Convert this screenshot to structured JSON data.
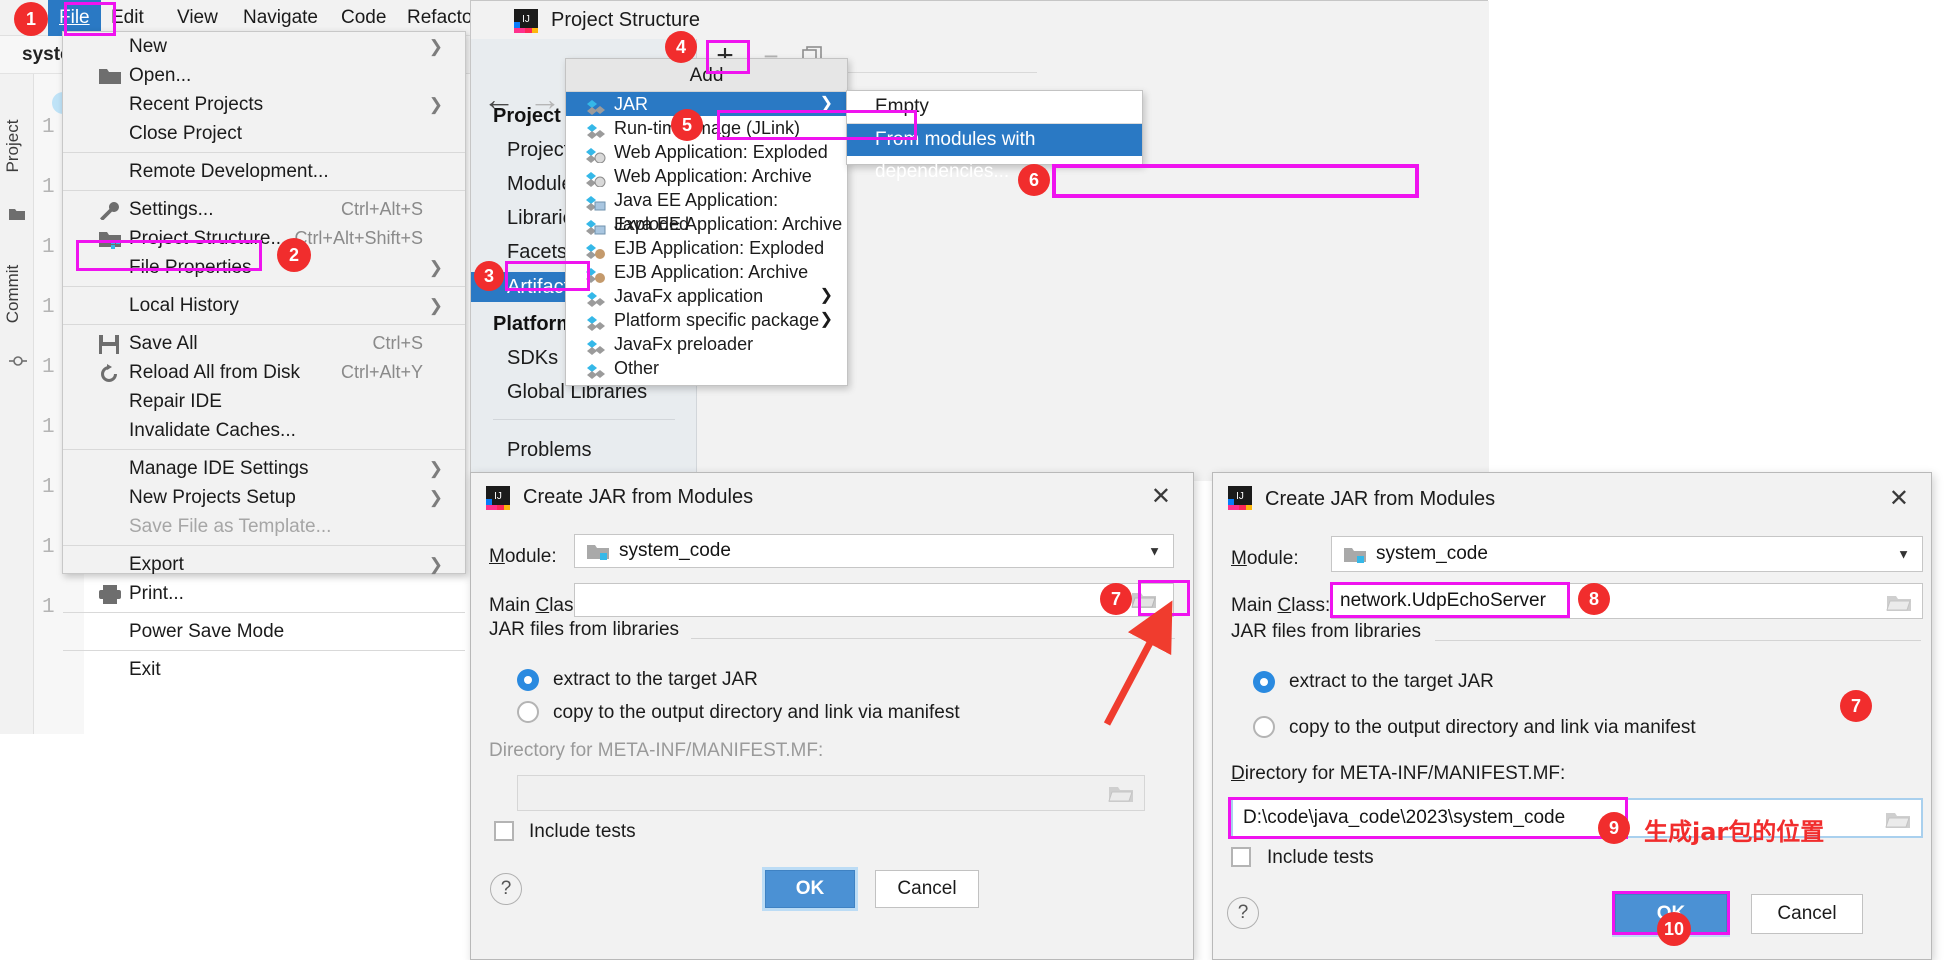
{
  "ide": {
    "menubar": [
      "File",
      "Edit",
      "View",
      "Navigate",
      "Code",
      "Refactor"
    ],
    "project_tab": "syste",
    "rail": [
      "Project",
      "Commit"
    ],
    "gutter_lines": [
      "1",
      "1",
      "1",
      "1",
      "1",
      "1",
      "1",
      "1",
      "1"
    ]
  },
  "file_menu": {
    "items": [
      {
        "label": "New",
        "accel": "",
        "arrow": true,
        "icon": "",
        "dim": false
      },
      {
        "label": "Open...",
        "accel": "",
        "arrow": false,
        "icon": "folder-icon",
        "dim": false
      },
      {
        "label": "Recent Projects",
        "accel": "",
        "arrow": true,
        "icon": "",
        "dim": false
      },
      {
        "label": "Close Project",
        "accel": "",
        "arrow": false,
        "icon": "",
        "dim": false
      },
      {
        "sep": true
      },
      {
        "label": "Remote Development...",
        "accel": "",
        "arrow": false,
        "icon": "",
        "dim": false
      },
      {
        "sep": true
      },
      {
        "label": "Settings...",
        "accel": "Ctrl+Alt+S",
        "arrow": false,
        "icon": "wrench-icon",
        "dim": false
      },
      {
        "label": "Project Structure...",
        "accel": "Ctrl+Alt+Shift+S",
        "arrow": false,
        "icon": "module-icon",
        "dim": false
      },
      {
        "label": "File Properties",
        "accel": "",
        "arrow": true,
        "icon": "",
        "dim": false
      },
      {
        "sep": true
      },
      {
        "label": "Local History",
        "accel": "",
        "arrow": true,
        "icon": "",
        "dim": false
      },
      {
        "sep": true
      },
      {
        "label": "Save All",
        "accel": "Ctrl+S",
        "arrow": false,
        "icon": "save-icon",
        "dim": false
      },
      {
        "label": "Reload All from Disk",
        "accel": "Ctrl+Alt+Y",
        "arrow": false,
        "icon": "reload-icon",
        "dim": false
      },
      {
        "label": "Repair IDE",
        "accel": "",
        "arrow": false,
        "icon": "",
        "dim": false
      },
      {
        "label": "Invalidate Caches...",
        "accel": "",
        "arrow": false,
        "icon": "",
        "dim": false
      },
      {
        "sep": true
      },
      {
        "label": "Manage IDE Settings",
        "accel": "",
        "arrow": true,
        "icon": "",
        "dim": false
      },
      {
        "label": "New Projects Setup",
        "accel": "",
        "arrow": true,
        "icon": "",
        "dim": false
      },
      {
        "label": "Save File as Template...",
        "accel": "",
        "arrow": false,
        "icon": "",
        "dim": true
      },
      {
        "sep": true
      },
      {
        "label": "Export",
        "accel": "",
        "arrow": true,
        "icon": "",
        "dim": false
      },
      {
        "label": "Print...",
        "accel": "",
        "arrow": false,
        "icon": "printer-icon",
        "dim": false
      },
      {
        "sep": true
      },
      {
        "label": "Power Save Mode",
        "accel": "",
        "arrow": false,
        "icon": "",
        "dim": false
      },
      {
        "sep": true
      },
      {
        "label": "Exit",
        "accel": "",
        "arrow": false,
        "icon": "",
        "dim": false
      }
    ]
  },
  "project_structure": {
    "title": "Project Structure",
    "groups": [
      {
        "title": "Project Settings",
        "items": [
          "Project",
          "Modules",
          "Libraries",
          "Facets",
          "Artifacts"
        ]
      },
      {
        "title": "Platform Settings",
        "items": [
          "SDKs",
          "Global Libraries"
        ]
      }
    ],
    "problems": "Problems",
    "selected_item": "Artifacts",
    "toolbar": {
      "add": "+",
      "remove": "−",
      "copy": "copy-icon"
    }
  },
  "add_menu": {
    "header": "Add",
    "items": [
      {
        "label": "JAR",
        "arrow": true,
        "selected": true,
        "icon": "jar-icon"
      },
      {
        "label": "Run-time image (JLink)",
        "arrow": false,
        "selected": false,
        "icon": "jlink-icon"
      },
      {
        "label": "Web Application: Exploded",
        "arrow": false,
        "selected": false,
        "icon": "web-icon"
      },
      {
        "label": "Web Application: Archive",
        "arrow": false,
        "selected": false,
        "icon": "web-icon"
      },
      {
        "label": "Java EE Application: Exploded",
        "arrow": false,
        "selected": false,
        "icon": "javaee-icon"
      },
      {
        "label": "Java EE Application: Archive",
        "arrow": false,
        "selected": false,
        "icon": "javaee-icon"
      },
      {
        "label": "EJB Application: Exploded",
        "arrow": false,
        "selected": false,
        "icon": "ejb-icon"
      },
      {
        "label": "EJB Application: Archive",
        "arrow": false,
        "selected": false,
        "icon": "ejb-icon"
      },
      {
        "label": "JavaFx application",
        "arrow": true,
        "selected": false,
        "icon": "javafx-icon"
      },
      {
        "label": "Platform specific package",
        "arrow": true,
        "selected": false,
        "icon": "javafx-icon"
      },
      {
        "label": "JavaFx preloader",
        "arrow": false,
        "selected": false,
        "icon": "javafx-icon"
      },
      {
        "label": "Other",
        "arrow": false,
        "selected": false,
        "icon": "other-icon"
      }
    ]
  },
  "jar_submenu": {
    "items": [
      {
        "label": "Empty",
        "selected": false
      },
      {
        "label": "From modules with dependencies...",
        "selected": true
      }
    ]
  },
  "dialog_left": {
    "title": "Create JAR from Modules",
    "close": "✕",
    "module_label": "Module:",
    "module_value": "system_code",
    "mainclass_label": "Main Class:",
    "mainclass_value": "",
    "group_label": "JAR files from libraries",
    "radio1": "extract to the target JAR",
    "radio2": "copy to the output directory and link via manifest",
    "radio_selected": 1,
    "dir_label": "Directory for META-INF/MANIFEST.MF:",
    "dir_value": "",
    "include_tests": "Include tests",
    "help": "?",
    "ok": "OK",
    "cancel": "Cancel"
  },
  "dialog_right": {
    "title": "Create JAR from Modules",
    "close": "✕",
    "module_label": "Module:",
    "module_value": "system_code",
    "mainclass_label": "Main Class:",
    "mainclass_value": "network.UdpEchoServer",
    "group_label": "JAR files from libraries",
    "radio1": "extract to the target JAR",
    "radio2": "copy to the output directory and link via manifest",
    "radio_selected": 1,
    "dir_label": "Directory for META-INF/MANIFEST.MF:",
    "dir_value": "D:\\code\\java_code\\2023\\system_code",
    "include_tests": "Include tests",
    "help": "?",
    "ok": "OK",
    "cancel": "Cancel"
  },
  "annotations": {
    "badges": [
      "1",
      "2",
      "3",
      "4",
      "5",
      "6",
      "7",
      "8",
      "7",
      "9",
      "10"
    ],
    "chinese_note": "生成jar包的位置",
    "highlight_color": "#ef13ef",
    "badge_color": "#f12d2d",
    "arrow_color": "#f03c2e"
  }
}
